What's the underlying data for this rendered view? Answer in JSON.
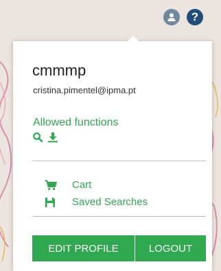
{
  "header": {
    "user_icon": "user-circle-icon",
    "help_label": "?"
  },
  "profile": {
    "username": "cmmmp",
    "email": "cristina.pimentel@ipma.pt"
  },
  "allowed": {
    "label": "Allowed functions",
    "icons": [
      "search-icon",
      "download-icon"
    ]
  },
  "menu": {
    "cart_label": "Cart",
    "cart_icon": "cart-icon",
    "saved_label": "Saved Searches",
    "saved_icon": "floppy-disk-icon"
  },
  "buttons": {
    "edit": "EDIT PROFILE",
    "logout": "LOGOUT"
  },
  "colors": {
    "accent": "#2fa84f",
    "help": "#1f4e79",
    "user": "#6f8a9c"
  }
}
